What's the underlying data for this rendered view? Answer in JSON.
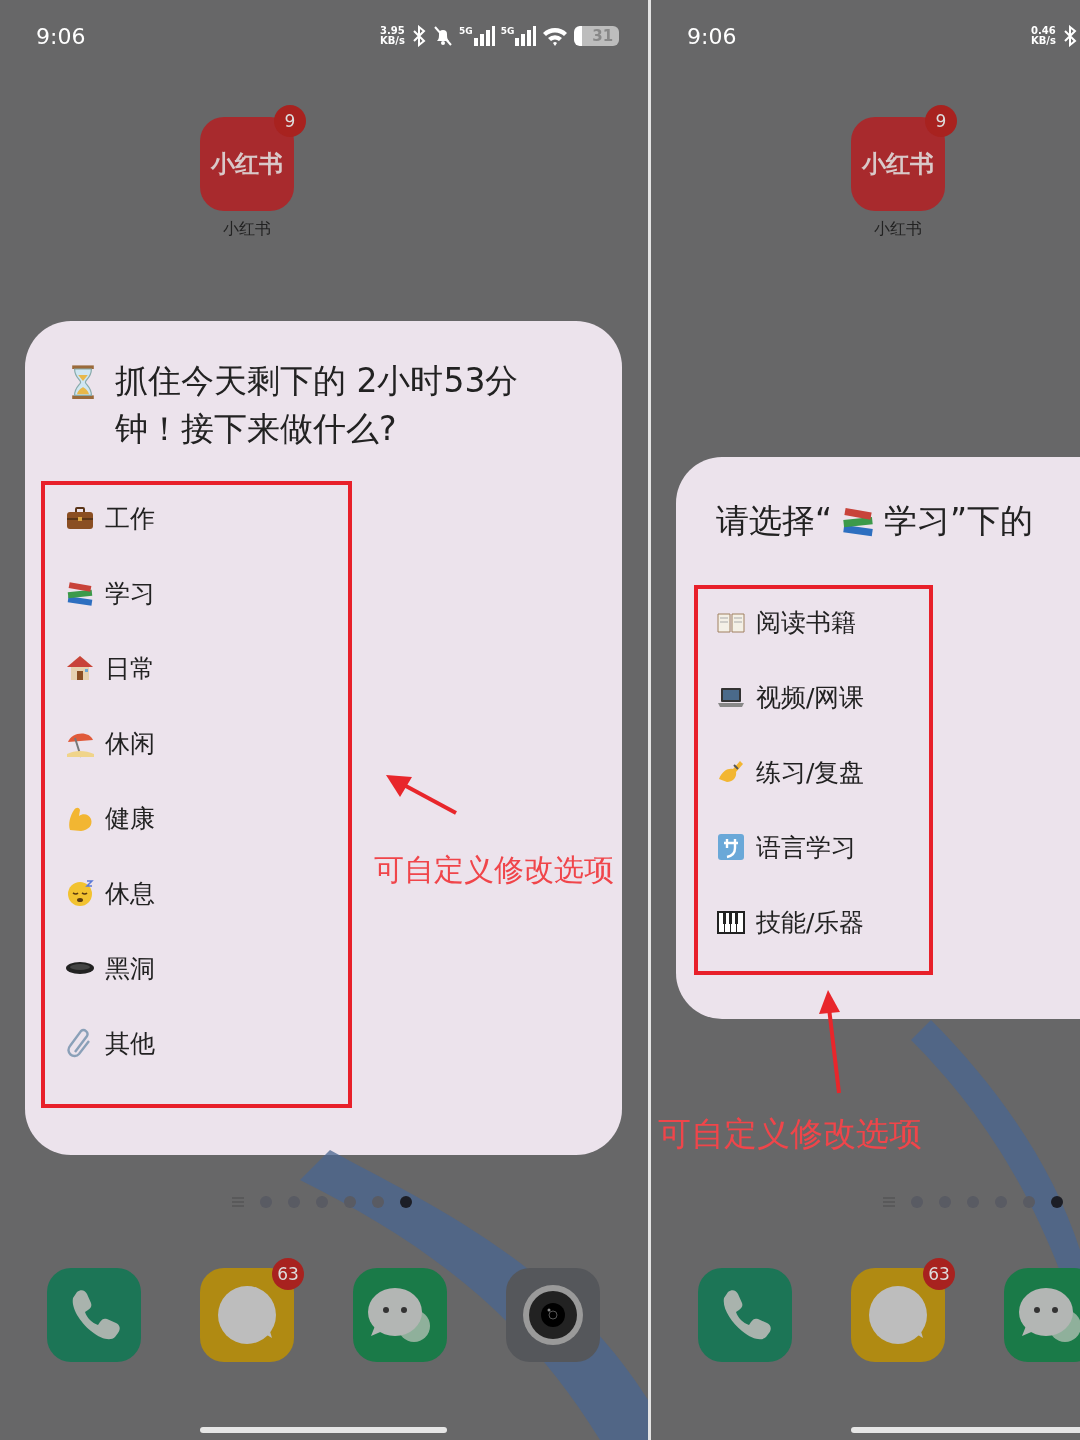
{
  "screens": [
    {
      "status_bar": {
        "time": "9:06",
        "speed_value": "3.95",
        "speed_unit": "KB/s",
        "network_labels": [
          "5G",
          "5G"
        ],
        "battery": "31"
      },
      "home_app": {
        "logo_text": "小红书",
        "badge": "9",
        "label": "小红书"
      },
      "widget": {
        "title": "抓住今天剩下的 2小时53分钟！接下来做什么?",
        "items": [
          {
            "label": "工作"
          },
          {
            "label": "学习"
          },
          {
            "label": "日常"
          },
          {
            "label": "休闲"
          },
          {
            "label": "健康"
          },
          {
            "label": "休息"
          },
          {
            "label": "黑洞"
          },
          {
            "label": "其他"
          }
        ]
      },
      "annotation": {
        "text": "可自定义修改选项"
      },
      "page_dots": [
        {
          "selected": false
        },
        {
          "selected": false
        },
        {
          "selected": false
        },
        {
          "selected": false
        },
        {
          "selected": false
        },
        {
          "selected": true
        }
      ],
      "dock": [
        {
          "kind": "phone"
        },
        {
          "kind": "messages",
          "badge": "63"
        },
        {
          "kind": "chat"
        },
        {
          "kind": "camera"
        }
      ]
    },
    {
      "status_bar": {
        "time": "9:06",
        "speed_value": "0.46",
        "speed_unit": "KB/s"
      },
      "home_app": {
        "logo_text": "小红书",
        "badge": "9",
        "label": "小红书"
      },
      "widget": {
        "title_lead": "请选择“",
        "title": "学习”下的",
        "items": [
          {
            "label": "阅读书籍"
          },
          {
            "label": "视频/网课"
          },
          {
            "label": "练习/复盘"
          },
          {
            "label": "语言学习"
          },
          {
            "label": "技能/乐器"
          }
        ]
      },
      "annotation": {
        "text": "可自定义修改选项"
      },
      "page_dots": [
        {
          "selected": false
        },
        {
          "selected": false
        },
        {
          "selected": false
        },
        {
          "selected": false
        },
        {
          "selected": false
        },
        {
          "selected": true
        }
      ],
      "dock": [
        {
          "kind": "phone"
        },
        {
          "kind": "messages",
          "badge": "63"
        },
        {
          "kind": "chat"
        }
      ]
    }
  ]
}
